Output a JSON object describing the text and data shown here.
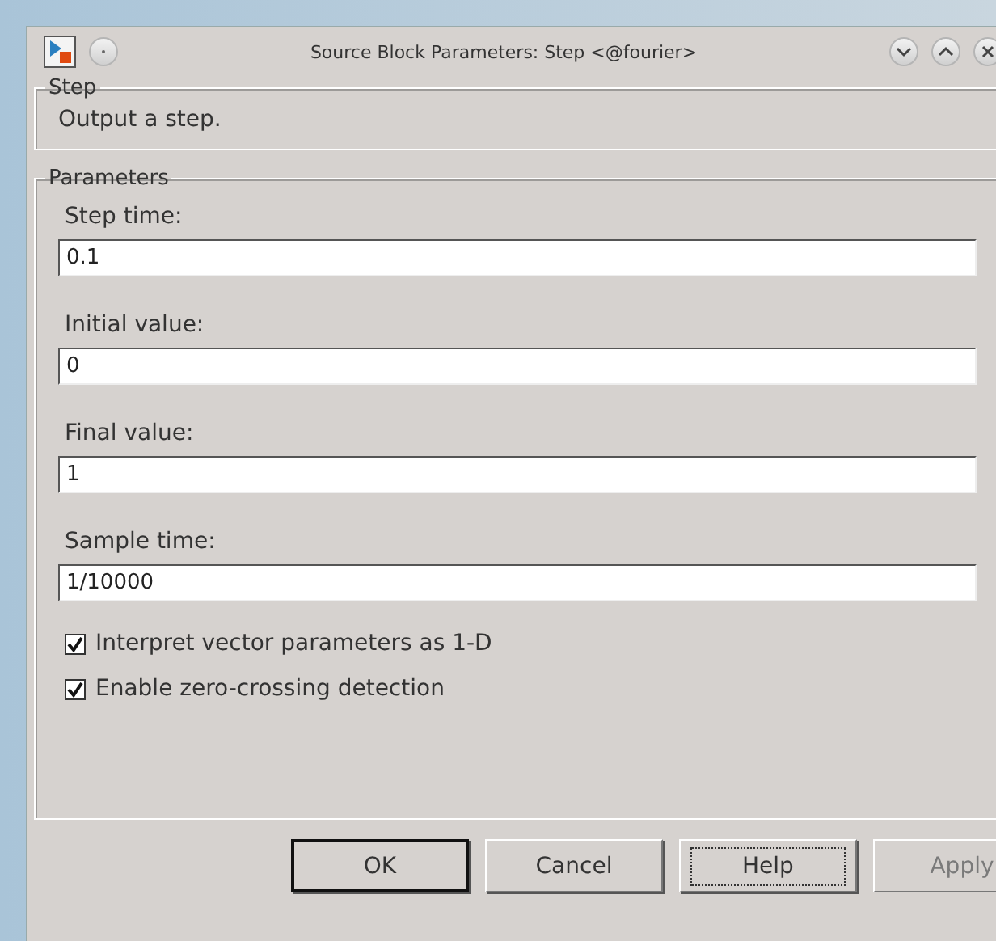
{
  "window": {
    "title": "Source Block Parameters: Step <@fourier>"
  },
  "description_group": {
    "title": "Step",
    "text": "Output a step."
  },
  "parameters_group": {
    "title": "Parameters",
    "fields": [
      {
        "label": "Step time:",
        "value": "0.1"
      },
      {
        "label": "Initial value:",
        "value": "0"
      },
      {
        "label": "Final value:",
        "value": "1"
      },
      {
        "label": "Sample time:",
        "value": "1/10000"
      }
    ],
    "checkboxes": [
      {
        "label": "Interpret vector parameters as 1-D",
        "checked": true
      },
      {
        "label": "Enable zero-crossing detection",
        "checked": true
      }
    ]
  },
  "buttons": [
    {
      "label": "OK",
      "default": true,
      "focused": false,
      "disabled": false
    },
    {
      "label": "Cancel",
      "default": false,
      "focused": false,
      "disabled": false
    },
    {
      "label": "Help",
      "default": false,
      "focused": true,
      "disabled": false
    },
    {
      "label": "Apply",
      "default": false,
      "focused": false,
      "disabled": true
    }
  ]
}
